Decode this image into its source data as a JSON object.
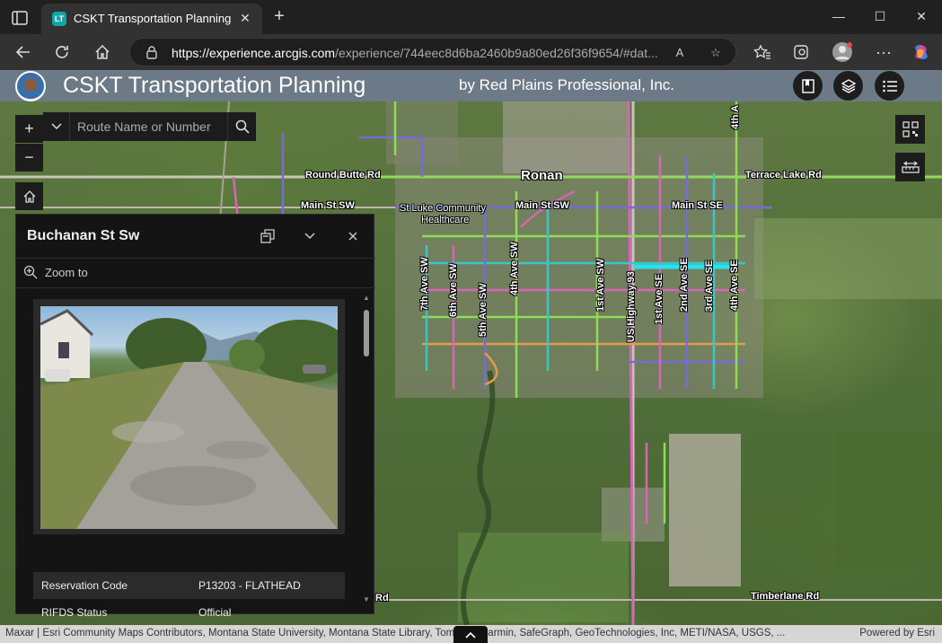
{
  "browser": {
    "tab_title": "CSKT Transportation Planning",
    "tab_favicon_text": "LT",
    "url_domain": "https://experience.arcgis.com",
    "url_path": "/experience/744eec8d6ba2460b9a80ed26f36f9654/#dat...",
    "read_aloud_label": "A"
  },
  "header": {
    "title": "CSKT Transportation Planning",
    "subtitle": "by Red Plains Professional, Inc."
  },
  "search": {
    "placeholder": "Route Name or Number"
  },
  "map": {
    "labels": {
      "city": "Ronan",
      "round_butte": "Round Butte Rd",
      "terrace_lake": "Terrace Lake Rd",
      "main_st_sw_w": "Main St SW",
      "main_st_sw_c": "Main St SW",
      "main_st_se": "Main St SE",
      "st_luke": "St Luke Community",
      "healthcare": "Healthcare",
      "ave_7th_sw": "7th Ave SW",
      "ave_6th_sw": "6th Ave SW",
      "ave_5th_sw": "5th Ave SW",
      "ave_4th_sw": "4th Ave SW",
      "ave_1st_sw": "1st Ave SW",
      "us_hwy": "US Highway 93",
      "ave_1st_se": "1st Ave SE",
      "ave_2nd_se": "2nd Ave SE",
      "ave_3rd_se": "3rd Ave SE",
      "ave_4th_se": "4th Ave SE",
      "ave_4th_n": "4th A",
      "timberlane": "Timberlane Rd",
      "rd_stub": "Rd"
    }
  },
  "popup": {
    "title": "Buchanan St Sw",
    "zoom_to": "Zoom to",
    "attributes": [
      {
        "key": "Reservation Code",
        "value": "P13203 - FLATHEAD"
      },
      {
        "key": "RIFDS Status",
        "value": "Official"
      }
    ]
  },
  "attribution": {
    "text": "Maxar | Esri Community Maps Contributors, Montana State University, Montana State Library, TomTom, Garmin, SafeGraph, GeoTechnologies, Inc, METI/NASA, USGS, ...",
    "powered_by": "Powered by Esri"
  },
  "colors": {
    "header_bg": "#6b7a86",
    "panel_bg": "#141414",
    "highlight_road": "#25e3ee",
    "road_pink": "#d765b8",
    "road_green": "#8edc55",
    "road_purple": "#7a6ad8",
    "road_cyan": "#3cc5c9",
    "road_orange": "#e49b4c"
  },
  "icons": {
    "sidebar": "sidebar-icon",
    "back": "back-arrow-icon",
    "refresh": "refresh-icon",
    "home": "home-icon",
    "lock": "lock-icon",
    "favorite": "star-icon",
    "collections": "collections-icon",
    "edge": "edge-icon",
    "profile": "profile-icon",
    "more": "more-icon",
    "copilot": "copilot-icon"
  }
}
